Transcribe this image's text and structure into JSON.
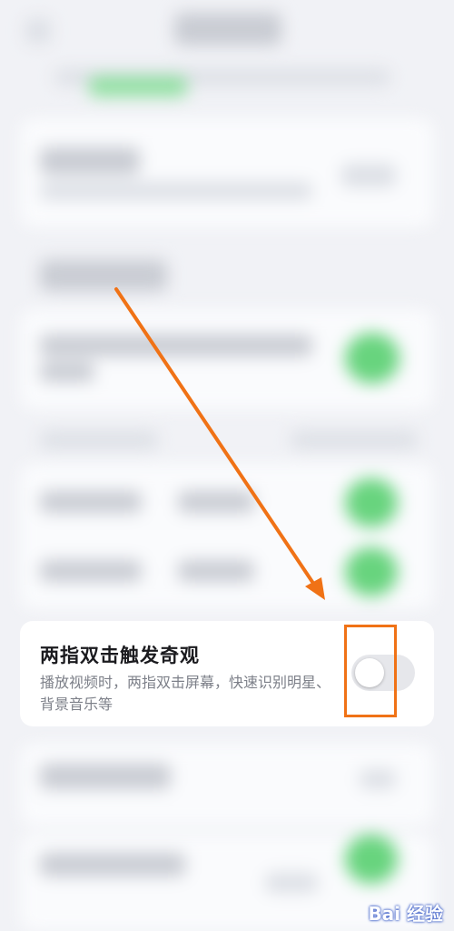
{
  "setting": {
    "title": "两指双击触发奇观",
    "description": "播放视频时，两指双击屏幕，快速识别明星、背景音乐等",
    "toggle_state": "off"
  },
  "colors": {
    "annotation": "#f07216",
    "toggle_on": "#68d47e",
    "toggle_off": "#e6e7eb"
  },
  "watermark": {
    "text": "Bai 经验"
  }
}
